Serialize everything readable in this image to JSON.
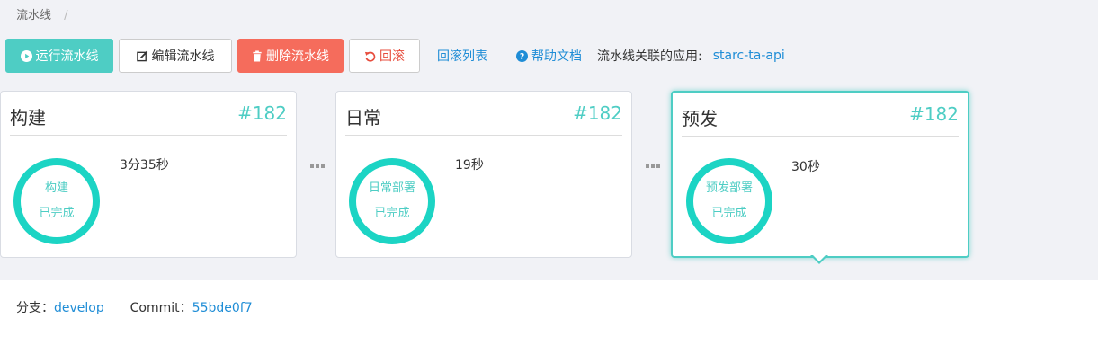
{
  "breadcrumb": {
    "current": "流水线",
    "separator": "/"
  },
  "toolbar": {
    "run_label": "运行流水线",
    "edit_label": "编辑流水线",
    "delete_label": "删除流水线",
    "rollback_label": "回滚",
    "rollback_list_label": "回滚列表",
    "help_label": "帮助文档",
    "app_label": "流水线关联的应用:",
    "app_name": "starc-ta-api"
  },
  "stages": [
    {
      "title": "构建",
      "number": "#182",
      "ring_name": "构建",
      "status": "已完成",
      "duration": "3分35秒"
    },
    {
      "title": "日常",
      "number": "#182",
      "ring_name": "日常部署",
      "status": "已完成",
      "duration": "19秒"
    },
    {
      "title": "预发",
      "number": "#182",
      "ring_name": "预发部署",
      "status": "已完成",
      "duration": "30秒"
    }
  ],
  "info": {
    "branch_label": "分支：",
    "branch_value": "develop",
    "commit_label": "Commit：",
    "commit_value": "55bde0f7"
  },
  "icons": {
    "run": "play-circle-icon",
    "edit": "edit-icon",
    "delete": "trash-icon",
    "rollback": "undo-icon",
    "help": "question-circle-icon",
    "connector": "ellipsis-icon"
  },
  "colors": {
    "accent": "#4ecdc4",
    "ring": "#1cd4c4",
    "danger": "#f56c5c",
    "rollback_text": "#e74c3c",
    "link": "#1f8dd6"
  }
}
